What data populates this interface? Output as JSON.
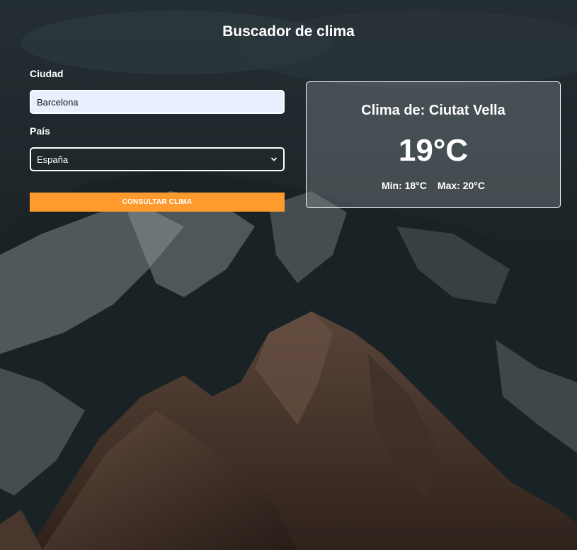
{
  "page": {
    "title": "Buscador de clima"
  },
  "form": {
    "city_label": "Ciudad",
    "city_value": "Barcelona",
    "country_label": "País",
    "country_selected": "España",
    "submit_label": "CONSULTAR CLIMA"
  },
  "weather": {
    "title": "Clima de: Ciutat Vella",
    "temperature": "19°C",
    "min_label": "Min:",
    "min_value": "18°C",
    "max_label": "Max:",
    "max_value": "20°C"
  },
  "colors": {
    "accent": "#ff9a2e",
    "input_bg": "#e8f0fe",
    "background": "#1e2629"
  },
  "icons": {
    "select_arrow": "chevron-down-icon"
  }
}
